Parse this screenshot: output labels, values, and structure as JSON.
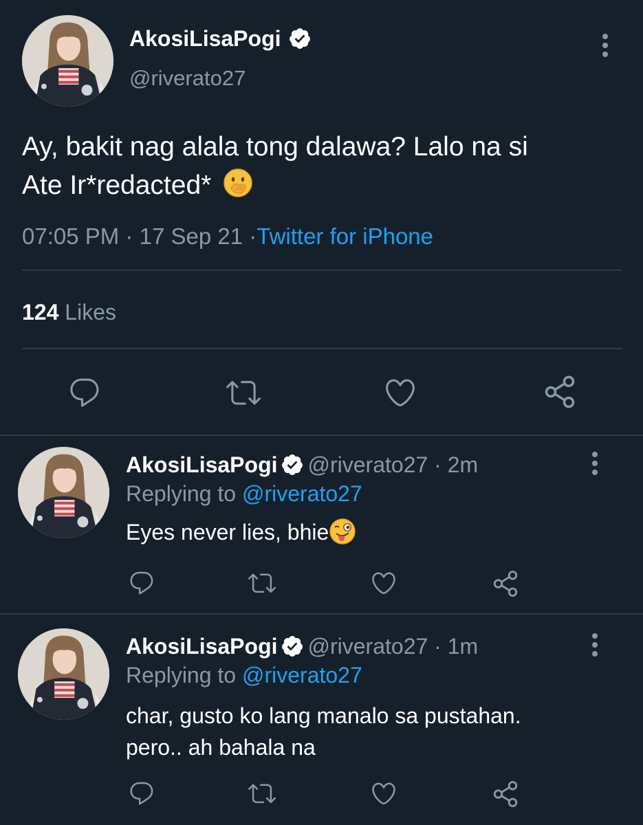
{
  "main_tweet": {
    "display_name": "AkosiLisaPogi",
    "handle": "@riverato27",
    "text_line1": "Ay, bakit nag alala tong dalawa? Lalo na si",
    "text_line2": "Ate Ir*redacted*",
    "emoji": "🫢",
    "time": "07:05 PM",
    "date": "17 Sep 21",
    "sep": "·",
    "client": "Twitter for iPhone",
    "likes_count": "124",
    "likes_label": "Likes"
  },
  "replies": [
    {
      "display_name": "AkosiLisaPogi",
      "handle": "@riverato27",
      "age": "· 2m",
      "replying_label": "Replying to",
      "replying_to": "@riverato27",
      "text_line1": "Eyes never lies, bhie",
      "emoji": "😜",
      "text_line2": ""
    },
    {
      "display_name": "AkosiLisaPogi",
      "handle": "@riverato27",
      "age": "· 1m",
      "replying_label": "Replying to",
      "replying_to": "@riverato27",
      "text_line1": "char, gusto ko lang manalo sa pustahan.",
      "emoji": "",
      "text_line2": "pero.. ah bahala na"
    }
  ],
  "colors": {
    "background": "#16202b",
    "text_secondary": "#8899a6",
    "accent": "#1da1f2",
    "divider": "#2f3b47"
  },
  "icons": [
    "verified-badge-icon",
    "more-dots-icon",
    "reply-icon",
    "retweet-icon",
    "like-icon",
    "share-icon"
  ]
}
